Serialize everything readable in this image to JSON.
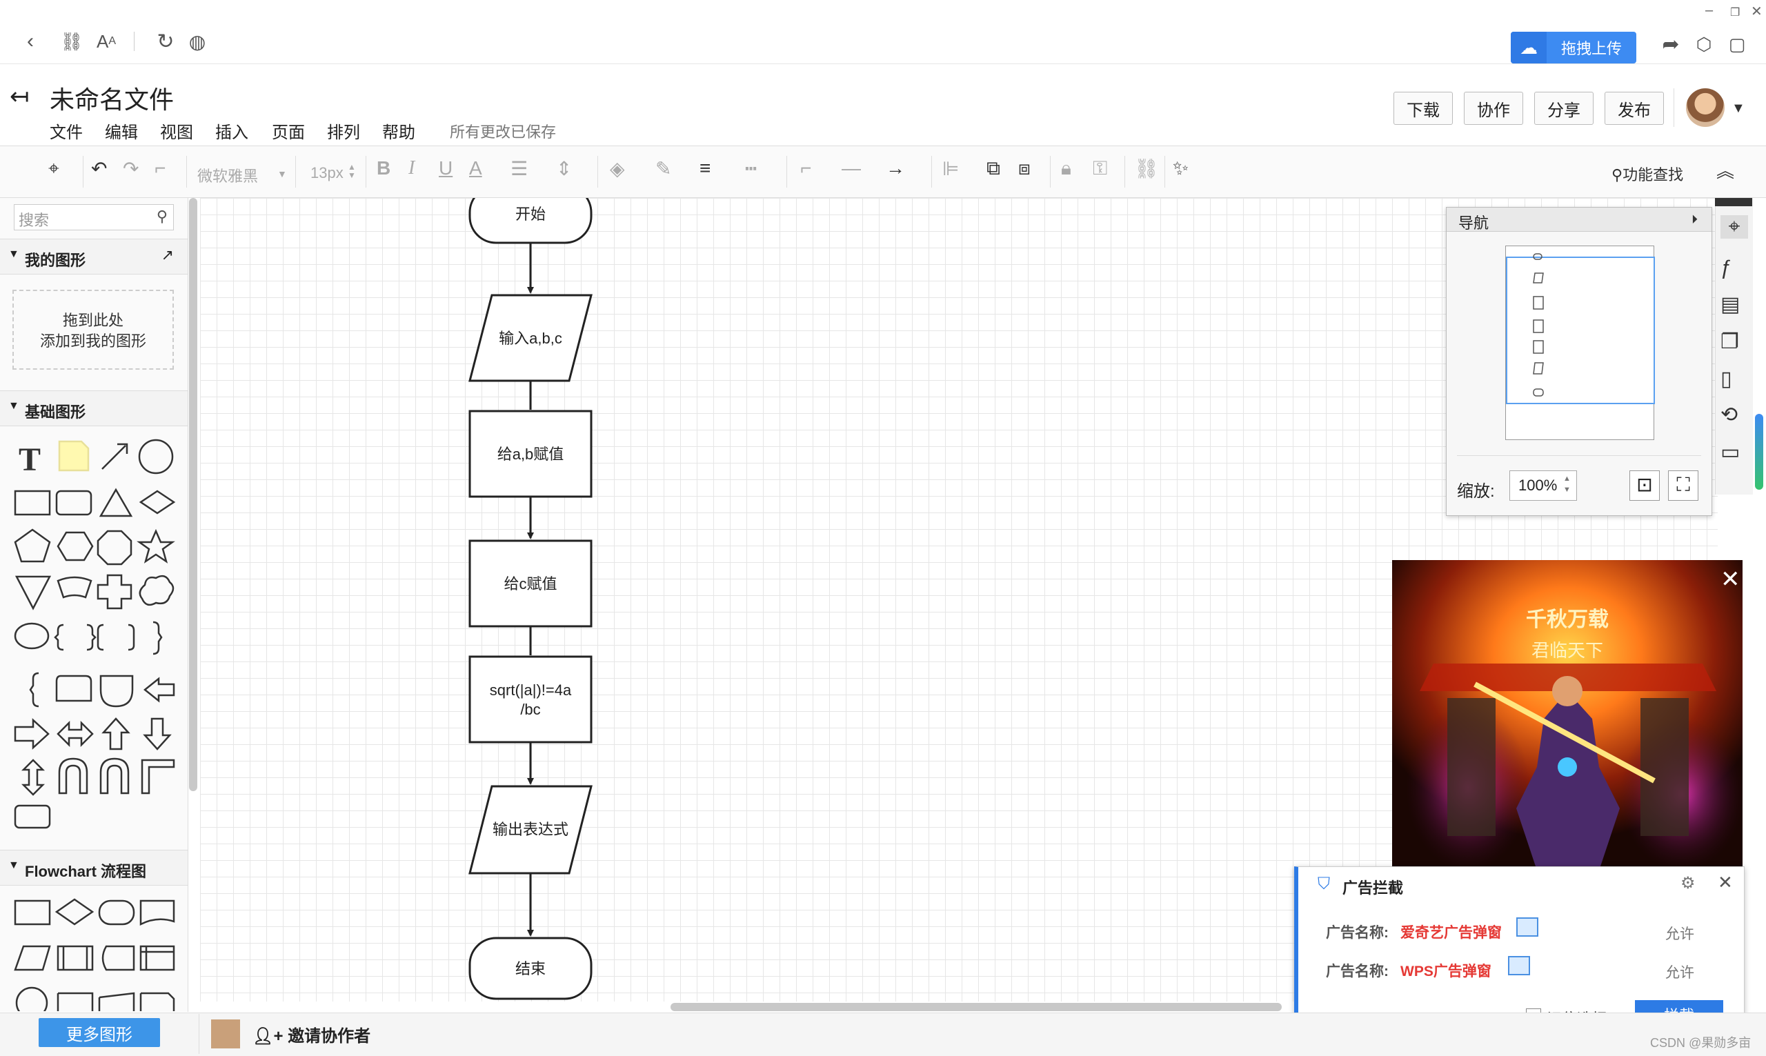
{
  "browser": {
    "upload_label": "拖拽上传"
  },
  "header": {
    "title": "未命名文件",
    "menu": [
      "文件",
      "编辑",
      "视图",
      "插入",
      "页面",
      "排列",
      "帮助"
    ],
    "save_status": "所有更改已保存",
    "buttons": {
      "download": "下载",
      "collaborate": "协作",
      "share": "分享",
      "publish": "发布"
    }
  },
  "toolbar": {
    "font_family": "微软雅黑",
    "font_size": "13px",
    "func_search": "功能查找"
  },
  "sidebar": {
    "search_placeholder": "搜索",
    "my_shapes_title": "我的图形",
    "drop_zone_line1": "拖到此处",
    "drop_zone_line2": "添加到我的图形",
    "basic_shapes_title": "基础图形",
    "flowchart_title": "Flowchart 流程图",
    "more_shapes": "更多图形",
    "invite": "邀请协作者"
  },
  "flowchart": {
    "nodes": [
      "开始",
      "输入a,b,c",
      "给a,b赋值",
      "给c赋值",
      "sqrt(|a|)!=4a",
      "/bc",
      "输出表达式",
      "结束"
    ]
  },
  "nav_panel": {
    "title": "导航",
    "zoom_label": "缩放:",
    "zoom_value": "100%"
  },
  "ad_popup": {
    "image_text_1": "千秋万载",
    "image_text_2": "君临天下"
  },
  "ad_block": {
    "title": "广告拦截",
    "row_label": "广告名称:",
    "row1_name": "爱奇艺广告弹窗",
    "row2_name": "WPS广告弹窗",
    "allow": "允许",
    "remember": "记住选择",
    "block": "拦截"
  },
  "watermark": "CSDN @果勋多亩",
  "colors": {
    "accent": "#3d8bf2",
    "ad_red": "#e53935"
  }
}
